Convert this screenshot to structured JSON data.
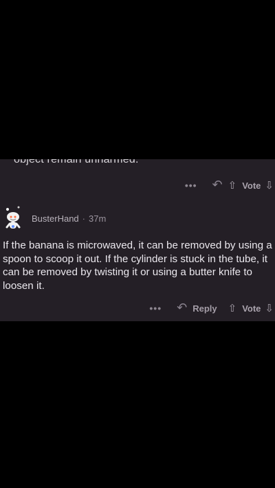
{
  "previous_comment": {
    "cut_off_text": "object remain unharmed.",
    "actions": {
      "more": "•••",
      "vote_label": "Vote"
    }
  },
  "comment": {
    "username": "BusterHand",
    "separator": "·",
    "timestamp": "37m",
    "body": "If the banana is microwaved, it can be removed by using a spoon to scoop it out. If the cylinder is stuck in the tube, it can be removed by twisting it or using a butter knife to loosen it.",
    "actions": {
      "more": "•••",
      "reply_label": "Reply",
      "vote_label": "Vote"
    }
  },
  "icons": {
    "more": "more-icon",
    "reply": "reply-arrow-icon",
    "upvote": "upvote-arrow-icon",
    "downvote": "downvote-arrow-icon",
    "avatar": "snoo-avatar-icon"
  },
  "colors": {
    "background": "#000000",
    "panel": "#241f26",
    "text": "#ebe8ee",
    "muted": "#a09aa3"
  }
}
